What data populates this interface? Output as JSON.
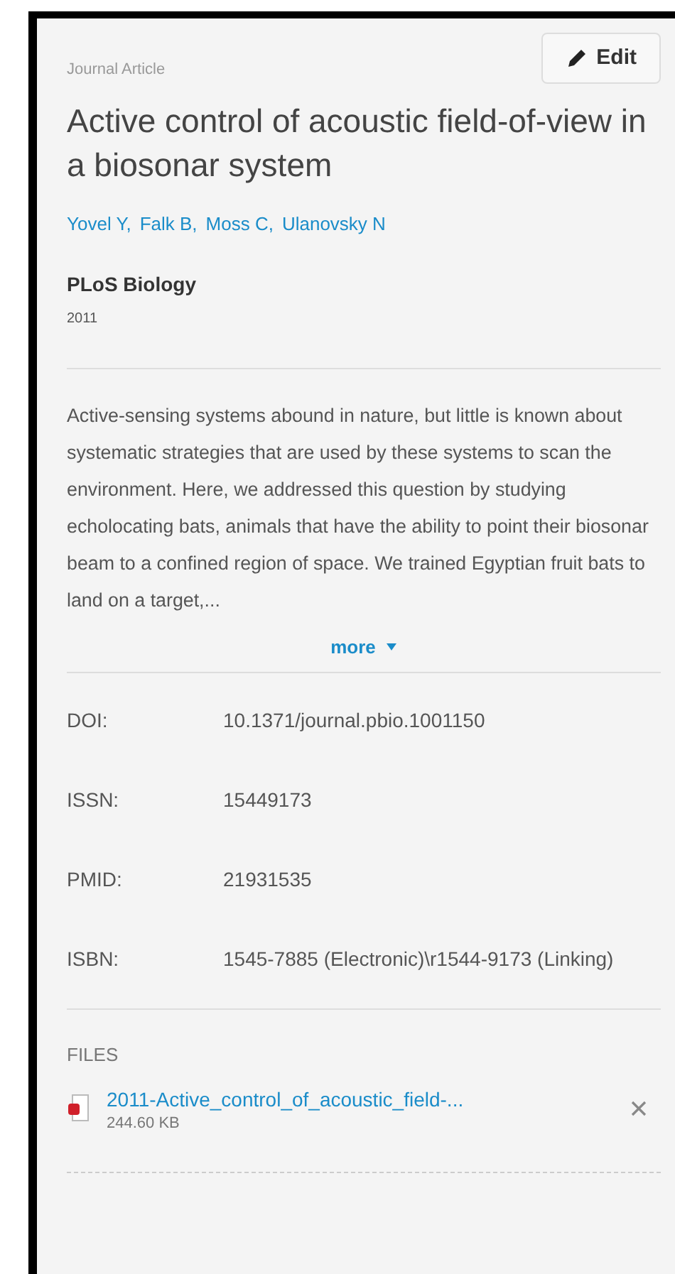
{
  "type_label": "Journal Article",
  "edit_button": "Edit",
  "title": "Active control of acoustic field-of-view in a biosonar system",
  "authors": [
    "Yovel Y,",
    "Falk B,",
    "Moss C,",
    "Ulanovsky N"
  ],
  "journal": "PLoS Biology",
  "year": "2011",
  "abstract": "Active-sensing systems abound in nature, but little is known about systematic strategies that are used by these systems to scan the environment. Here, we addressed this question by studying echolocating bats, animals that have the ability to point their biosonar beam to a confined region of space. We trained Egyptian fruit bats to land on a target,...",
  "more_link": "more",
  "identifiers": [
    {
      "label": "DOI:",
      "value": "10.1371/journal.pbio.1001150"
    },
    {
      "label": "ISSN:",
      "value": "15449173"
    },
    {
      "label": "PMID:",
      "value": "21931535"
    },
    {
      "label": "ISBN:",
      "value": "1545-7885 (Electronic)\\r1544-9173 (Linking)"
    }
  ],
  "files": {
    "heading": "FILES",
    "items": [
      {
        "name": "2011-Active_control_of_acoustic_field-...",
        "size": "244.60 KB"
      }
    ]
  }
}
